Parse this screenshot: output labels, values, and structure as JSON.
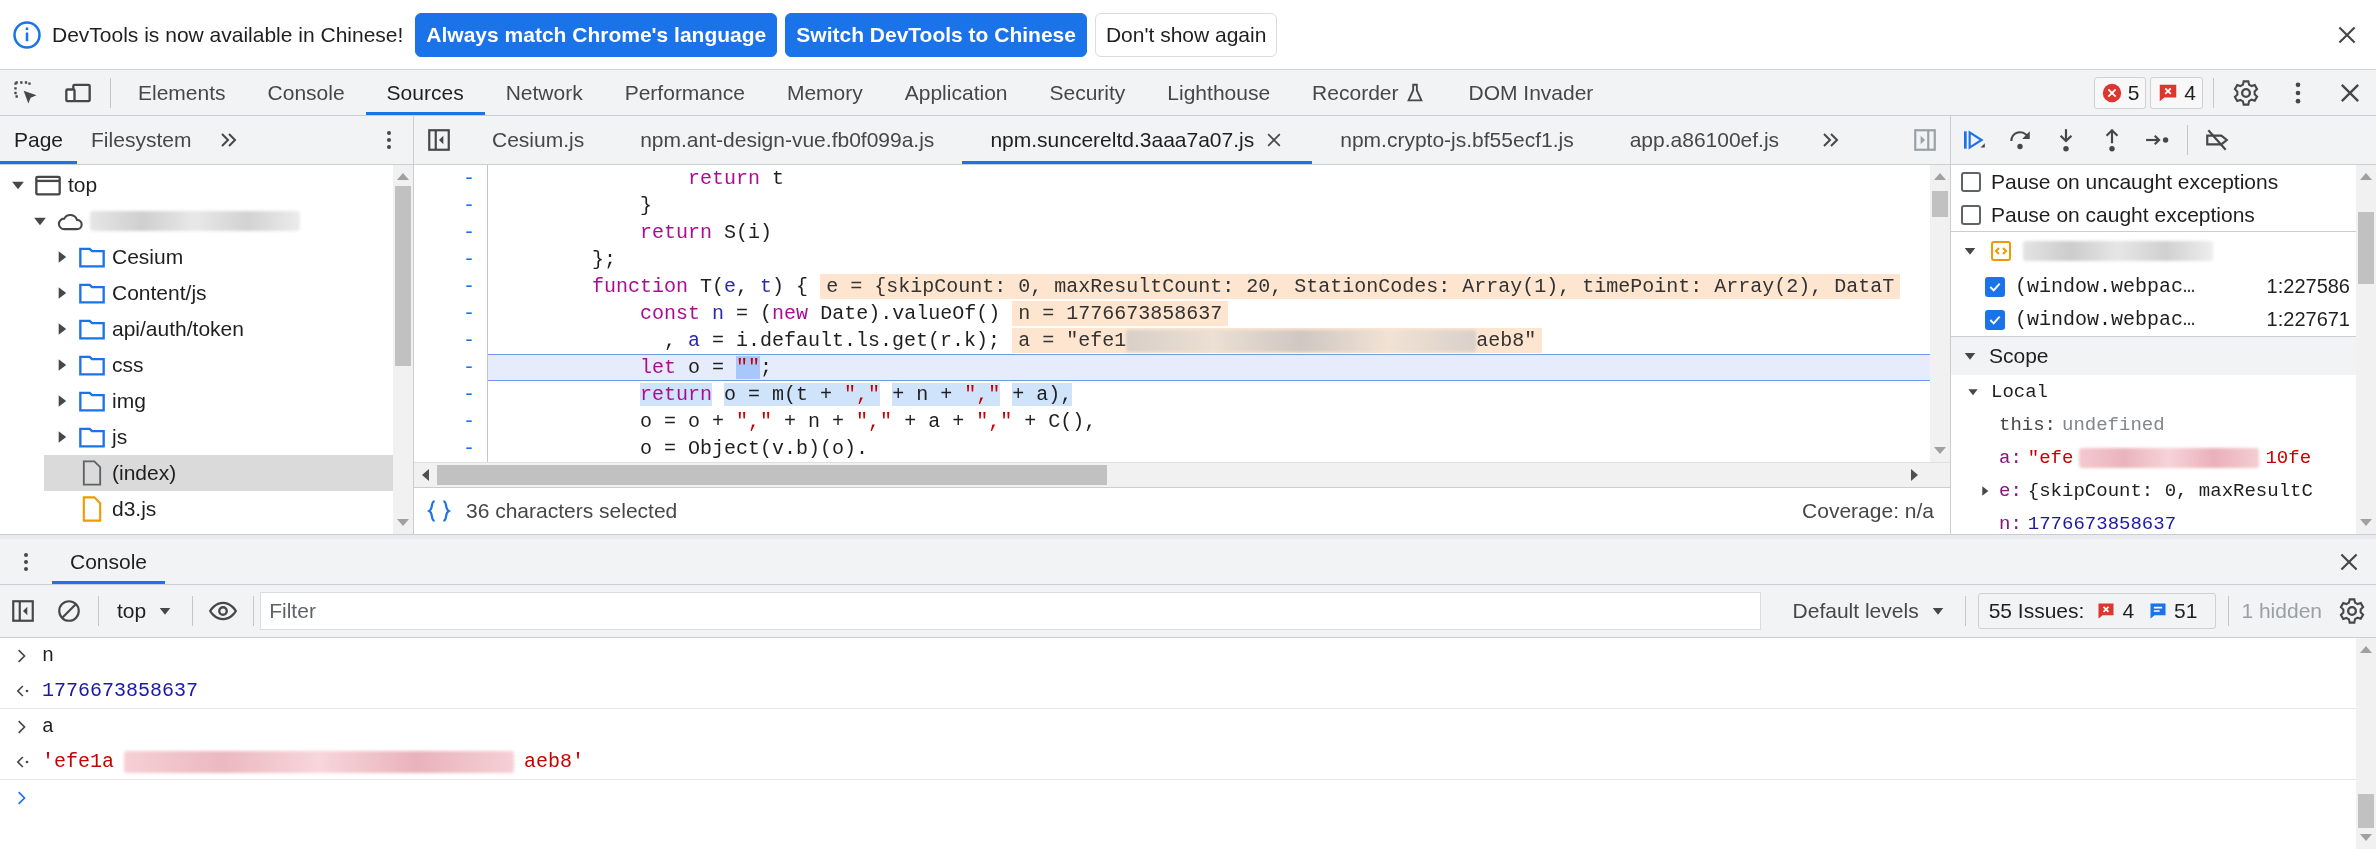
{
  "infobar": {
    "message": "DevTools is now available in Chinese!",
    "buttons": [
      {
        "label": "Always match Chrome's language",
        "kind": "primary"
      },
      {
        "label": "Switch DevTools to Chinese",
        "kind": "primary"
      },
      {
        "label": "Don't show again",
        "kind": "secondary"
      }
    ]
  },
  "main_tabs": [
    {
      "label": "Elements",
      "selected": false,
      "experimental": false
    },
    {
      "label": "Console",
      "selected": false,
      "experimental": false
    },
    {
      "label": "Sources",
      "selected": true,
      "experimental": false
    },
    {
      "label": "Network",
      "selected": false,
      "experimental": false
    },
    {
      "label": "Performance",
      "selected": false,
      "experimental": false
    },
    {
      "label": "Memory",
      "selected": false,
      "experimental": false
    },
    {
      "label": "Application",
      "selected": false,
      "experimental": false
    },
    {
      "label": "Security",
      "selected": false,
      "experimental": false
    },
    {
      "label": "Lighthouse",
      "selected": false,
      "experimental": false
    },
    {
      "label": "Recorder",
      "selected": false,
      "experimental": true
    },
    {
      "label": "DOM Invader",
      "selected": false,
      "experimental": false
    }
  ],
  "counters": {
    "errors": "5",
    "issues": "4"
  },
  "navigator": {
    "tabs": [
      {
        "label": "Page",
        "selected": true
      },
      {
        "label": "Filesystem",
        "selected": false
      }
    ],
    "tree": [
      {
        "kind": "frame",
        "label": "top",
        "expanded": true,
        "selected": false,
        "children": [
          {
            "kind": "origin",
            "expanded": true,
            "selected": false,
            "children": [
              {
                "kind": "folder",
                "label": "Cesium",
                "expanded": false,
                "selected": false
              },
              {
                "kind": "folder",
                "label": "Content/js",
                "expanded": false,
                "selected": false
              },
              {
                "kind": "folder",
                "label": "api/auth/token",
                "expanded": false,
                "selected": false
              },
              {
                "kind": "folder",
                "label": "css",
                "expanded": false,
                "selected": false
              },
              {
                "kind": "folder",
                "label": "img",
                "expanded": false,
                "selected": false
              },
              {
                "kind": "folder",
                "label": "js",
                "expanded": false,
                "selected": false
              },
              {
                "kind": "file",
                "label": "(index)",
                "selected": true
              },
              {
                "kind": "script",
                "label": "d3.js",
                "selected": false
              }
            ]
          }
        ]
      }
    ]
  },
  "editor": {
    "tabs": [
      {
        "label": "Cesium.js",
        "selected": false
      },
      {
        "label": "npm.ant-design-vue.fb0f099a.js",
        "selected": false
      },
      {
        "label": "npm.suncereltd.3aaa7a07.js",
        "selected": true
      },
      {
        "label": "npm.crypto-js.bf55ecf1.js",
        "selected": false
      },
      {
        "label": "app.a86100ef.js",
        "selected": false
      }
    ],
    "lines": [
      {
        "marker": "-",
        "current": false,
        "tokens": [
          {
            "text": "                return",
            "kind": "keyword",
            "selected": false
          },
          {
            "text": " t",
            "kind": "plain",
            "selected": false
          }
        ]
      },
      {
        "marker": "-",
        "current": false,
        "tokens": [
          {
            "text": "            }",
            "kind": "plain",
            "selected": false
          }
        ]
      },
      {
        "marker": "-",
        "current": false,
        "tokens": [
          {
            "text": "            return",
            "kind": "keyword",
            "selected": false
          },
          {
            "text": " S(i)",
            "kind": "plain",
            "selected": false
          }
        ]
      },
      {
        "marker": "-",
        "current": false,
        "tokens": [
          {
            "text": "        };",
            "kind": "plain",
            "selected": false
          }
        ]
      },
      {
        "marker": "-",
        "current": false,
        "tokens": [
          {
            "text": "        function",
            "kind": "keyword",
            "selected": false
          },
          {
            "text": " T(",
            "kind": "plain",
            "selected": false
          },
          {
            "text": "e",
            "kind": "param",
            "selected": false
          },
          {
            "text": ", ",
            "kind": "plain",
            "selected": false
          },
          {
            "text": "t",
            "kind": "param",
            "selected": false
          },
          {
            "text": ") {",
            "kind": "plain",
            "selected": false
          }
        ],
        "annotation": [
          {
            "kind": "text",
            "text": "e = {skipCount: 0, maxResultCount: 20, StationCodes: Array(1), timePoint: Array(2), DataT"
          }
        ]
      },
      {
        "marker": "-",
        "current": false,
        "tokens": [
          {
            "text": "            const",
            "kind": "keyword",
            "selected": false
          },
          {
            "text": " n",
            "kind": "param",
            "selected": false
          },
          {
            "text": " = (",
            "kind": "plain",
            "selected": false
          },
          {
            "text": "new",
            "kind": "keyword",
            "selected": false
          },
          {
            "text": " Date).valueOf()",
            "kind": "plain",
            "selected": false
          }
        ],
        "annotation": [
          {
            "kind": "text",
            "text": "n = 1776673858637"
          }
        ]
      },
      {
        "marker": "-",
        "current": false,
        "tokens": [
          {
            "text": "              , ",
            "kind": "plain",
            "selected": false
          },
          {
            "text": "a",
            "kind": "param",
            "selected": false
          },
          {
            "text": " = i.default.ls.get(r.k);",
            "kind": "plain",
            "selected": false
          }
        ],
        "annotation": [
          {
            "kind": "text",
            "text": "a = \"efe1"
          },
          {
            "kind": "redacted"
          },
          {
            "kind": "text",
            "text": "aeb8\""
          }
        ]
      },
      {
        "marker": "-",
        "current": true,
        "tokens": [
          {
            "text": "            let",
            "kind": "keyword",
            "selected": false
          },
          {
            "text": " o = ",
            "kind": "plain",
            "selected": false
          },
          {
            "text": "\"\"",
            "kind": "string",
            "selected": true
          },
          {
            "text": ";",
            "kind": "plain",
            "selected": false
          }
        ]
      },
      {
        "marker": "-",
        "current": false,
        "tokens": [
          {
            "text": "            return",
            "kind": "keyword",
            "selected": true
          },
          {
            "text": " o = m(t + ",
            "kind": "plain",
            "selected": true
          },
          {
            "text": "\",\"",
            "kind": "string",
            "selected": true
          },
          {
            "text": " + n + ",
            "kind": "plain",
            "selected": true
          },
          {
            "text": "\",\"",
            "kind": "string",
            "selected": true
          },
          {
            "text": " + a),",
            "kind": "plain",
            "selected": true
          }
        ]
      },
      {
        "marker": "-",
        "current": false,
        "tokens": [
          {
            "text": "            o = o + ",
            "kind": "plain",
            "selected": false
          },
          {
            "text": "\",\"",
            "kind": "string",
            "selected": false
          },
          {
            "text": " + n + ",
            "kind": "plain",
            "selected": false
          },
          {
            "text": "\",\"",
            "kind": "string",
            "selected": false
          },
          {
            "text": " + a + ",
            "kind": "plain",
            "selected": false
          },
          {
            "text": "\",\"",
            "kind": "string",
            "selected": false
          },
          {
            "text": " + C(),",
            "kind": "plain",
            "selected": false
          }
        ]
      },
      {
        "marker": "-",
        "current": false,
        "tokens": [
          {
            "text": "            o = Object(v.b)(o).",
            "kind": "plain",
            "selected": false
          }
        ]
      }
    ],
    "status": "36 characters selected",
    "coverage": "Coverage: n/a"
  },
  "debugger": {
    "pause_options": [
      {
        "label": "Pause on uncaught exceptions",
        "checked": false
      },
      {
        "label": "Pause on caught exceptions",
        "checked": false
      }
    ],
    "breakpoint_files": [
      {
        "expanded": true,
        "breakpoints": [
          {
            "label": "(window.webpac…",
            "location": "1:227586",
            "checked": true
          },
          {
            "label": "(window.webpac…",
            "location": "1:227671",
            "checked": true
          }
        ]
      }
    ],
    "scope": {
      "title": "Scope",
      "expanded": true,
      "groups": [
        {
          "title": "Local",
          "expanded": true,
          "vars": [
            {
              "name": "this:",
              "kind": "undefined",
              "expandable": false,
              "parts": [
                {
                  "kind": "text",
                  "text": "undefined"
                }
              ]
            },
            {
              "name": "a:",
              "kind": "string",
              "expandable": false,
              "parts": [
                {
                  "kind": "text",
                  "text": "\"efe"
                },
                {
                  "kind": "redacted"
                },
                {
                  "kind": "text",
                  "text": "10fe"
                }
              ]
            },
            {
              "name": "e:",
              "kind": "object",
              "expandable": true,
              "expanded": false,
              "parts": [
                {
                  "kind": "text",
                  "text": "{skipCount: 0, maxResultC"
                }
              ]
            },
            {
              "name": "n:",
              "kind": "number",
              "expandable": false,
              "parts": [
                {
                  "kind": "text",
                  "text": "1776673858637"
                }
              ]
            }
          ]
        }
      ]
    }
  },
  "drawer": {
    "tabs": [
      {
        "label": "Console",
        "selected": true
      }
    ],
    "context": "top",
    "filter_placeholder": "Filter",
    "levels": "Default levels",
    "issues": {
      "label": "55 Issues:",
      "errors": "4",
      "infos": "51"
    },
    "hidden": "1 hidden",
    "messages": [
      {
        "kind": "input",
        "parts": [
          {
            "kind": "text",
            "text": "n"
          }
        ]
      },
      {
        "kind": "number_result",
        "parts": [
          {
            "kind": "text",
            "text": "1776673858637"
          }
        ]
      },
      {
        "kind": "input",
        "parts": [
          {
            "kind": "text",
            "text": "a"
          }
        ]
      },
      {
        "kind": "string_result",
        "parts": [
          {
            "kind": "text",
            "text": "'efe1a"
          },
          {
            "kind": "redacted"
          },
          {
            "kind": "text",
            "text": "aeb8'"
          }
        ]
      },
      {
        "kind": "prompt"
      }
    ]
  }
}
